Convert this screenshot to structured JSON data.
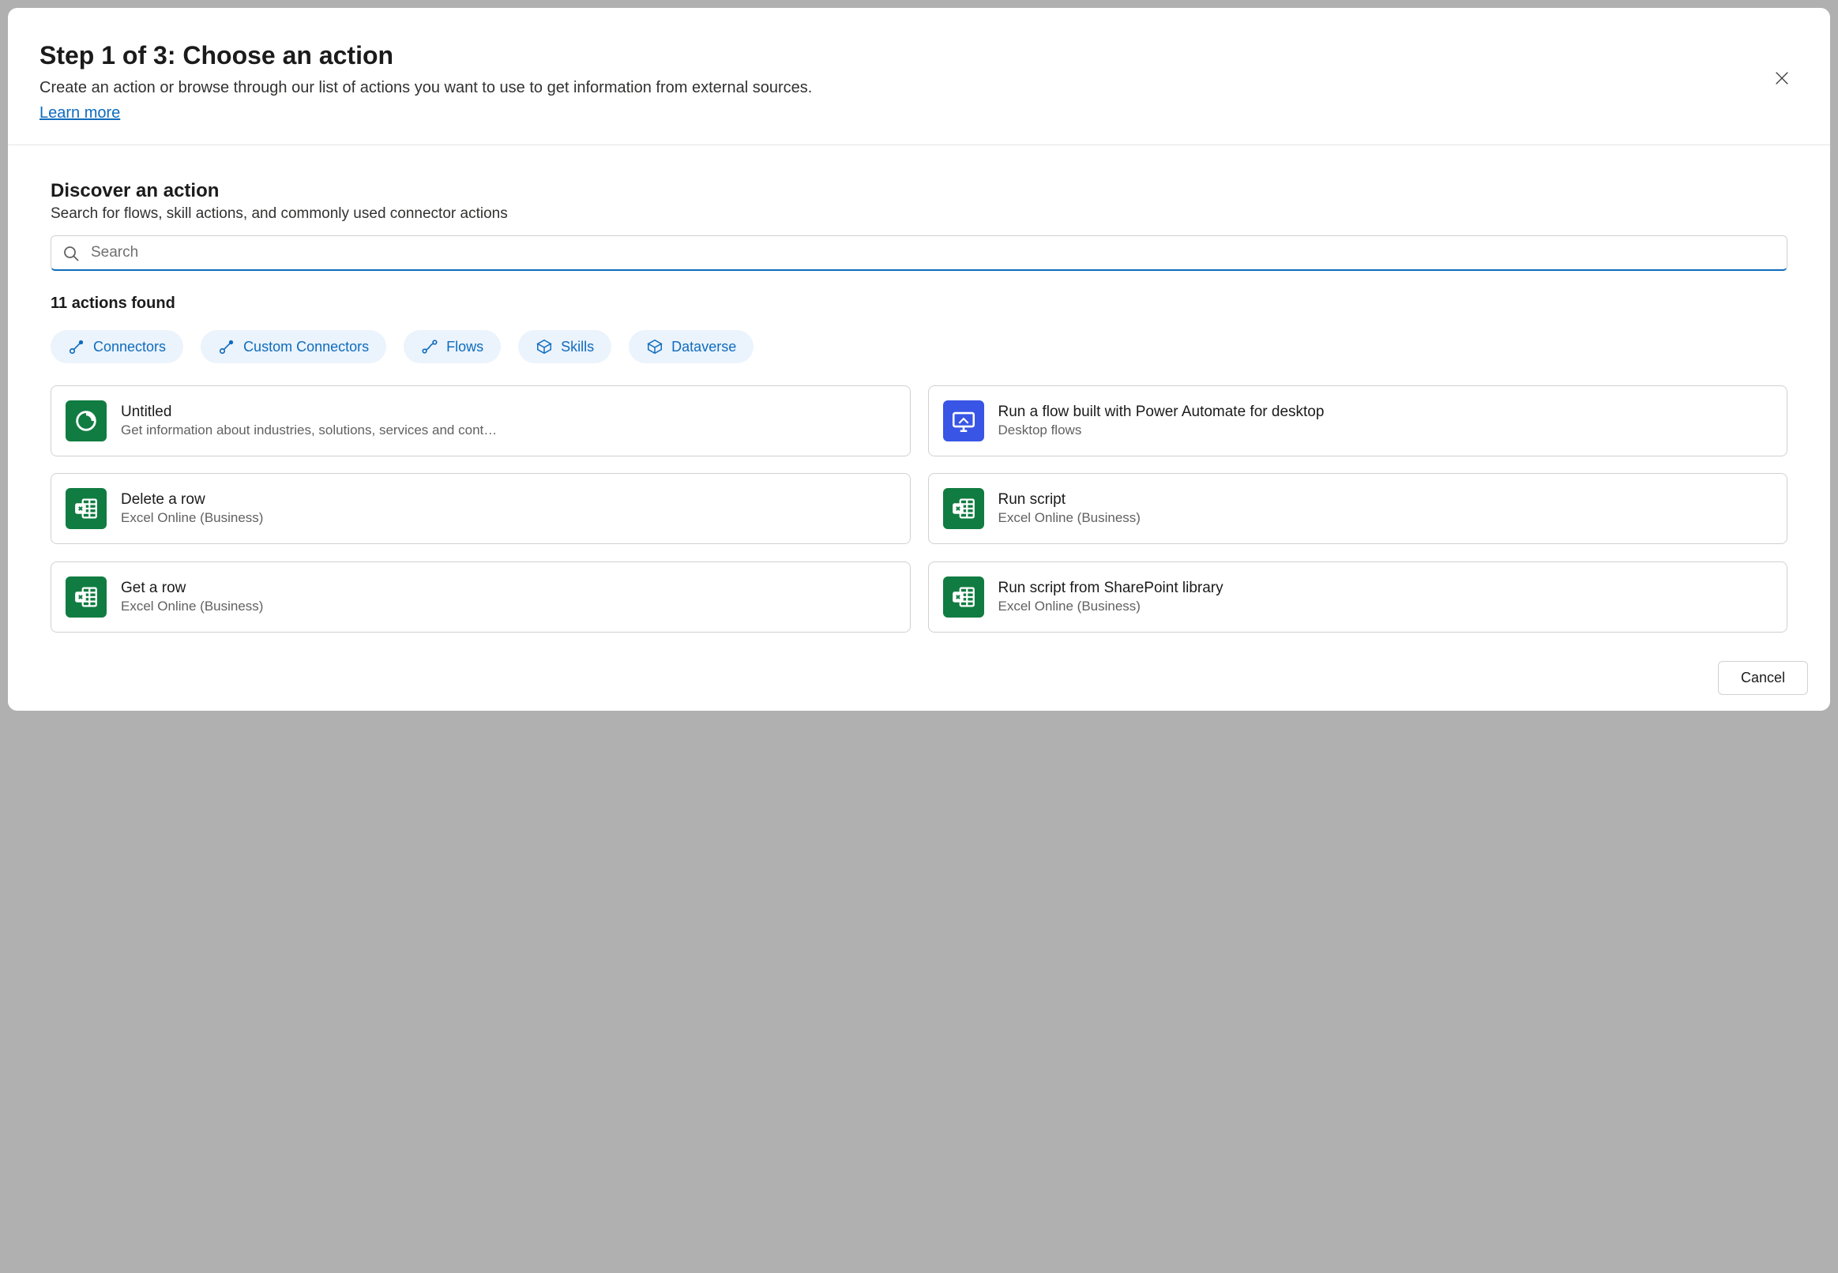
{
  "header": {
    "title": "Step 1 of 3: Choose an action",
    "subtitle": "Create an action or browse through our list of actions you want to use to get information from external sources.",
    "learn_more": "Learn more"
  },
  "body": {
    "discover_title": "Discover an action",
    "discover_sub": "Search for flows, skill actions, and commonly used connector actions",
    "search_placeholder": "Search",
    "results_count": "11 actions found",
    "chips": [
      {
        "label": "Connectors",
        "icon": "connector-icon"
      },
      {
        "label": "Custom Connectors",
        "icon": "connector-icon"
      },
      {
        "label": "Flows",
        "icon": "flow-icon"
      },
      {
        "label": "Skills",
        "icon": "cube-icon"
      },
      {
        "label": "Dataverse",
        "icon": "cube-icon"
      }
    ],
    "cards": [
      {
        "title": "Untitled",
        "sub": "Get information about industries, solutions, services and cont…",
        "icon": "loop-icon",
        "color": "green"
      },
      {
        "title": "Run a flow built with Power Automate for desktop",
        "sub": "Desktop flows",
        "icon": "desktop-flow-icon",
        "color": "blue"
      },
      {
        "title": "Delete a row",
        "sub": "Excel Online (Business)",
        "icon": "excel-icon",
        "color": "green"
      },
      {
        "title": "Run script",
        "sub": "Excel Online (Business)",
        "icon": "excel-icon",
        "color": "green"
      },
      {
        "title": "Get a row",
        "sub": "Excel Online (Business)",
        "icon": "excel-icon",
        "color": "green"
      },
      {
        "title": "Run script from SharePoint library",
        "sub": "Excel Online (Business)",
        "icon": "excel-icon",
        "color": "green"
      }
    ]
  },
  "footer": {
    "cancel": "Cancel"
  }
}
